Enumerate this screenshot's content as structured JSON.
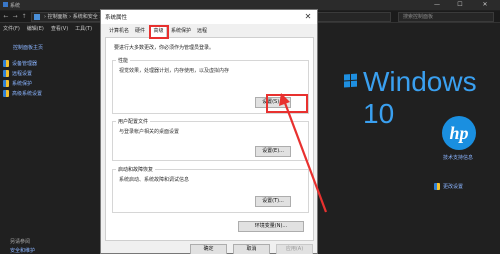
{
  "background_window": {
    "title": "系统",
    "controls": {
      "minimize": "—",
      "maximize": "☐",
      "close": "✕"
    },
    "nav": {
      "back": "←",
      "forward": "→",
      "up": "↑"
    },
    "path": "› 控制面板 › 系统和安全 › 系统",
    "search_placeholder": "搜索控制面板",
    "menu": [
      "文件(F)",
      "编辑(E)",
      "查看(V)",
      "工具(T)"
    ],
    "sidebar": {
      "home": "控制面板主页",
      "items": [
        "设备管理器",
        "远程设置",
        "系统保护",
        "高级系统设置"
      ]
    },
    "see_also": "另请参阅",
    "security_link": "安全和维护",
    "windows_brand": "Windows 10",
    "hp_logo": "hp",
    "support_info": "技术支持信息",
    "change_settings": "更改设置"
  },
  "dialog": {
    "title": "系统属性",
    "close": "✕",
    "tabs": [
      "计算机名",
      "硬件",
      "高级",
      "系统保护",
      "远程"
    ],
    "selected_tab": "高级",
    "admin_note": "要进行大多数更改，你必须作为管理员登录。",
    "performance": {
      "title": "性能",
      "desc": "视觉效果，处理器计划，内存使用，以及虚拟内存",
      "button": "设置(S)..."
    },
    "user_profiles": {
      "title": "用户配置文件",
      "desc": "与登录帐户相关的桌面设置",
      "button": "设置(E)..."
    },
    "startup_recovery": {
      "title": "启动和故障恢复",
      "desc": "系统启动、系统故障和调试信息",
      "button": "设置(T)..."
    },
    "env_button": "环境变量(N)...",
    "footer": {
      "ok": "确定",
      "cancel": "取消",
      "apply": "应用(A)"
    }
  },
  "colors": {
    "highlight": "#e8312f",
    "windows_blue": "#3aa0f0",
    "hp_blue": "#1a8fe0",
    "link": "#8ab4ff"
  }
}
